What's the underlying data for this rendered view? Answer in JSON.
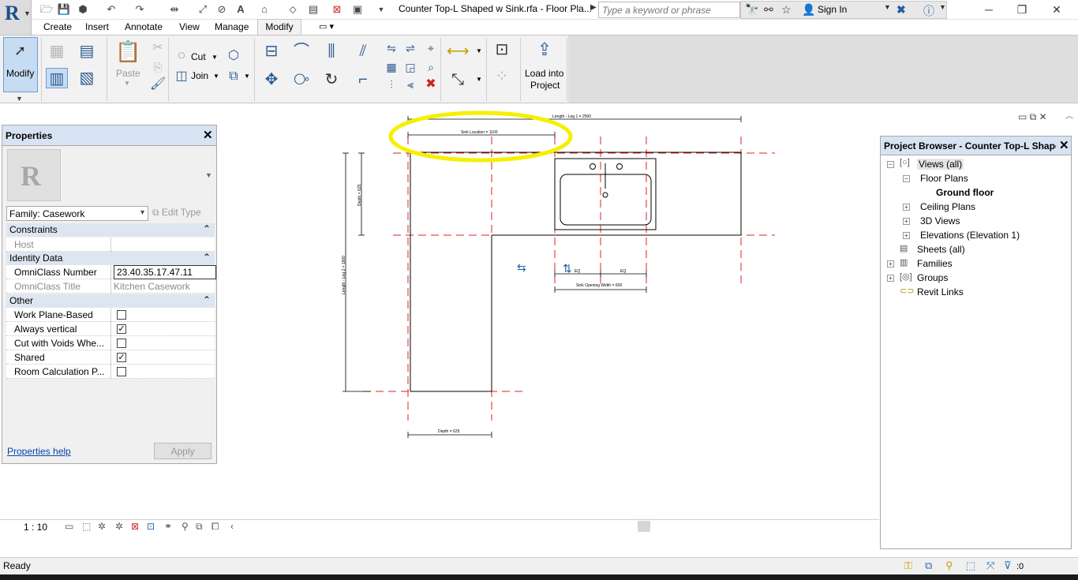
{
  "app": {
    "doc_title": "Counter Top-L Shaped w Sink.rfa - Floor Pla...",
    "search_placeholder": "Type a keyword or phrase",
    "sign_in": "Sign In"
  },
  "ribbon": {
    "tabs": [
      "Create",
      "Insert",
      "Annotate",
      "View",
      "Manage",
      "Modify"
    ],
    "active_tab": "Modify",
    "modify_label": "Modify",
    "paste_label": "Paste",
    "cut_label": "Cut",
    "join_label": "Join",
    "load_line1": "Load into",
    "load_line2": "Project"
  },
  "properties": {
    "title": "Properties",
    "family": "Family: Casework",
    "edit_type": "Edit Type",
    "sections": {
      "constraints": "Constraints",
      "identity": "Identity Data",
      "other": "Other"
    },
    "host_label": "Host",
    "omni_number_label": "OmniClass Number",
    "omni_number_value": "23.40.35.17.47.11",
    "omni_title_label": "OmniClass Title",
    "omni_title_value": "Kitchen Casework",
    "work_plane_label": "Work Plane-Based",
    "always_vertical_label": "Always vertical",
    "cut_voids_label": "Cut with Voids Whe...",
    "shared_label": "Shared",
    "room_calc_label": "Room Calculation P...",
    "checkboxes": {
      "work_plane": false,
      "always_vertical": true,
      "cut_voids": false,
      "shared": true,
      "room_calc": false
    },
    "help_link": "Properties help",
    "apply": "Apply"
  },
  "browser": {
    "title": "Project Browser - Counter Top-L Shaped...",
    "views_all": "Views (all)",
    "floor_plans": "Floor Plans",
    "ground_floor": "Ground floor",
    "ceiling_plans": "Ceiling Plans",
    "views_3d": "3D Views",
    "elevations": "Elevations (Elevation 1)",
    "sheets": "Sheets (all)",
    "families": "Families",
    "groups": "Groups",
    "revit_links": "Revit Links"
  },
  "drawing": {
    "dim_length1": "Length - Leg 1 = 2500",
    "dim_sink_location": "Sink Location = 1100",
    "dim_depth_left": "Depth = 625",
    "dim_length2": "Length - Leg 2 = 1800",
    "dim_eq1": "EQ",
    "dim_eq2": "EQ",
    "dim_sink_opening": "Sink Opening Width = 600",
    "dim_depth_bottom": "Depth = 625",
    "highlight_color": "#f5f000",
    "ref_plane_color": "#e02020"
  },
  "viewbar": {
    "scale": "1 : 10"
  },
  "status": {
    "text": "Ready",
    "filter_count": ":0"
  }
}
